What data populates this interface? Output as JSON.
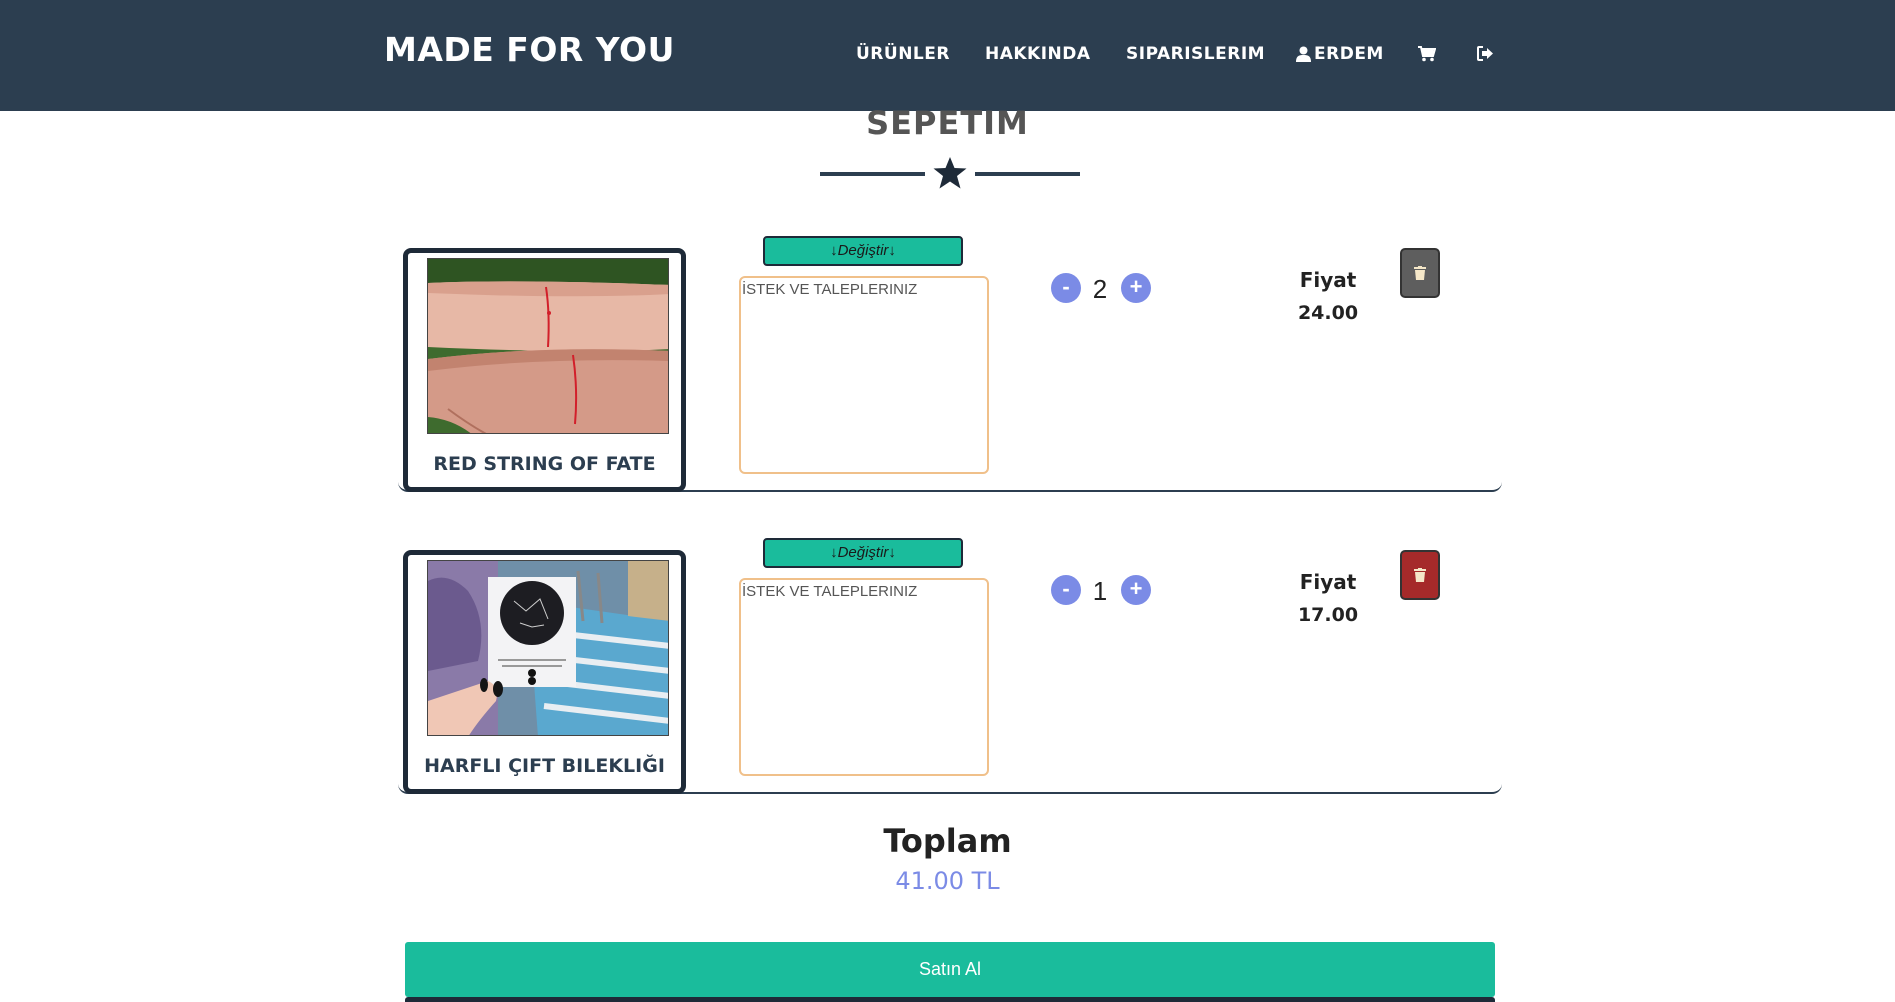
{
  "header": {
    "brand": "MADE FOR YOU",
    "nav": {
      "products": "ÜRÜNLER",
      "about": "HAKKINDA",
      "orders": "SIPARISLERIM",
      "user": "ERDEM"
    },
    "icons": [
      "user-icon",
      "cart-icon",
      "logout-icon"
    ]
  },
  "page": {
    "title": "SEPETIM",
    "divider_icon": "star-icon"
  },
  "cart": {
    "items": [
      {
        "name": "RED STRING OF FATE",
        "change_label": "↓Değiştir↓",
        "request_placeholder": "İSTEK VE TALEPLERINIZ",
        "quantity": "2",
        "price_label": "Fiyat",
        "price": "24.00",
        "delete_color": "#5e5e5e"
      },
      {
        "name": "HARFLI ÇIFT BILEKLIĞI",
        "change_label": "↓Değiştir↓",
        "request_placeholder": "İSTEK VE TALEPLERINIZ",
        "quantity": "1",
        "price_label": "Fiyat",
        "price": "17.00",
        "delete_color": "#a52a2a"
      }
    ],
    "qty_minus": "-",
    "qty_plus": "+"
  },
  "summary": {
    "total_label": "Toplam",
    "total_value": "41.00 TL",
    "buy_label": "Satın Al"
  },
  "colors": {
    "navbar": "#2c3e50",
    "accent": "#1abc9c",
    "qty": "#7b8be6"
  }
}
